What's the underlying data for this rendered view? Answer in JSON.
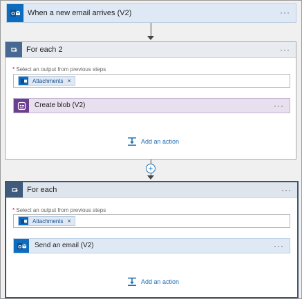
{
  "trigger": {
    "title": "When a new email arrives (V2)",
    "menu": "···",
    "icon": "outlook-icon"
  },
  "foreach2": {
    "title": "For each 2",
    "menu": "···",
    "field_required_mark": "*",
    "field_label": "Select an output from previous steps",
    "token_label": "Attachments",
    "token_remove": "×",
    "action": {
      "title": "Create blob (V2)",
      "menu": "···",
      "icon": "blob-storage-icon"
    },
    "add_action": "Add an action"
  },
  "connector_plus": "+",
  "foreach": {
    "title": "For each",
    "menu": "···",
    "field_required_mark": "*",
    "field_label": "Select an output from previous steps",
    "token_label": "Attachments",
    "token_remove": "×",
    "action": {
      "title": "Send an email (V2)",
      "menu": "···",
      "icon": "outlook-icon"
    },
    "add_action": "Add an action"
  },
  "colors": {
    "outlook_blue": "#0f6cbd",
    "loop_header": "#486991",
    "blob_purple": "#6b3f8f",
    "link_blue": "#1f6fb2"
  }
}
